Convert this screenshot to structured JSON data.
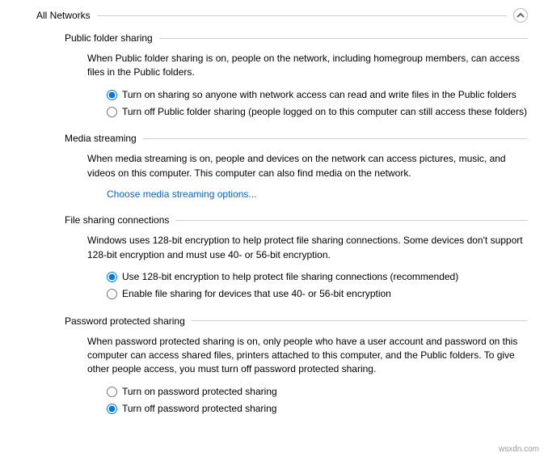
{
  "header": {
    "title": "All Networks"
  },
  "sections": {
    "publicFolder": {
      "title": "Public folder sharing",
      "desc": "When Public folder sharing is on, people on the network, including homegroup members, can access files in the Public folders.",
      "opt1": "Turn on sharing so anyone with network access can read and write files in the Public folders",
      "opt2": "Turn off Public folder sharing (people logged on to this computer can still access these folders)"
    },
    "mediaStreaming": {
      "title": "Media streaming",
      "desc": "When media streaming is on, people and devices on the network can access pictures, music, and videos on this computer. This computer can also find media on the network.",
      "link": "Choose media streaming options..."
    },
    "fileSharing": {
      "title": "File sharing connections",
      "desc": "Windows uses 128-bit encryption to help protect file sharing connections. Some devices don't support 128-bit encryption and must use 40- or 56-bit encryption.",
      "opt1": "Use 128-bit encryption to help protect file sharing connections (recommended)",
      "opt2": "Enable file sharing for devices that use 40- or 56-bit encryption"
    },
    "passwordProtected": {
      "title": "Password protected sharing",
      "desc": "When password protected sharing is on, only people who have a user account and password on this computer can access shared files, printers attached to this computer, and the Public folders. To give other people access, you must turn off password protected sharing.",
      "opt1": "Turn on password protected sharing",
      "opt2": "Turn off password protected sharing"
    }
  },
  "watermark": "wsxdn.com"
}
